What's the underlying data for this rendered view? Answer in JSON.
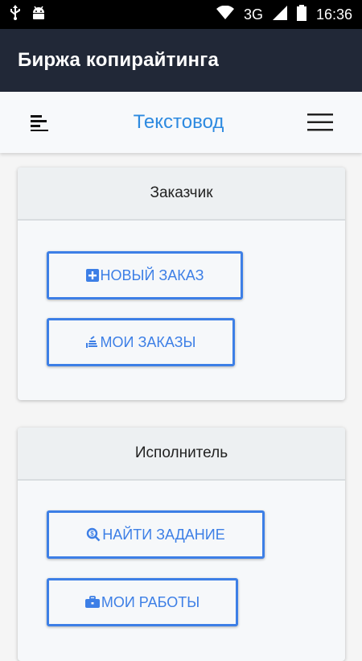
{
  "status_bar": {
    "network": "3G",
    "time": "16:36",
    "icons": [
      "usb-icon",
      "android-icon",
      "wifi-icon",
      "signal-icon",
      "battery-icon"
    ]
  },
  "app_bar": {
    "title": "Биржа копирайтинга"
  },
  "site_nav": {
    "brand": "Текстовод",
    "left_icon": "align-left-icon",
    "right_icon": "hamburger-menu-icon"
  },
  "customer": {
    "title": "Заказчик",
    "new_order": "НОВЫЙ ЗАКАЗ",
    "my_orders": "МОИ ЗАКАЗЫ"
  },
  "performer": {
    "title": "Исполнитель",
    "find_task": "НАЙТИ ЗАДАНИЕ",
    "my_works": "МОИ РАБОТЫ"
  },
  "colors": {
    "accent": "#3d7fe6",
    "brand": "#2d8ae0",
    "app_bar": "#212837"
  }
}
